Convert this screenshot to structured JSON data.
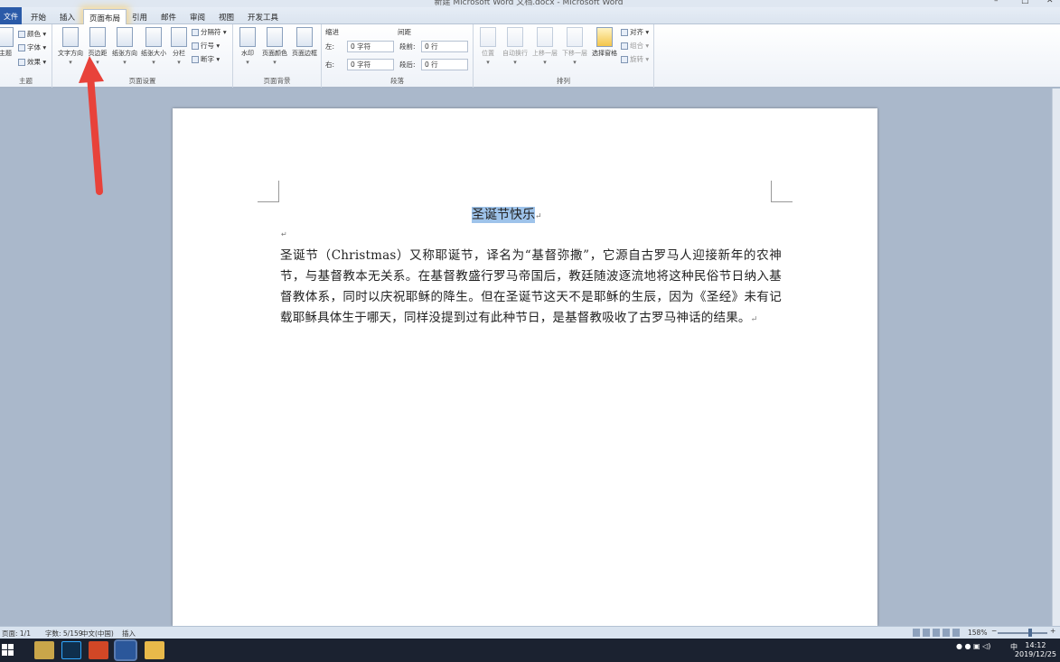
{
  "window": {
    "title": "新建 Microsoft Word 文档.docx - Microsoft Word",
    "minimize": "–",
    "maximize": "□",
    "close": "✕"
  },
  "tabs": [
    {
      "label": "文件"
    },
    {
      "label": "开始"
    },
    {
      "label": "插入"
    },
    {
      "label": "页面布局"
    },
    {
      "label": "引用"
    },
    {
      "label": "邮件"
    },
    {
      "label": "审阅"
    },
    {
      "label": "视图"
    },
    {
      "label": "开发工具"
    }
  ],
  "ribbon": {
    "theme_group": {
      "label": "主题",
      "theme_button": "主题",
      "colors": "颜色",
      "fonts": "字体",
      "effects": "效果"
    },
    "page_setup_group": {
      "label": "页面设置",
      "text_direction": "文字方向",
      "margins": "页边距",
      "orientation": "纸张方向",
      "size": "纸张大小",
      "columns": "分栏",
      "breaks": "分隔符",
      "line_numbers": "行号",
      "hyphenation": "断字"
    },
    "page_background_group": {
      "label": "页面背景",
      "watermark": "水印",
      "page_color": "页面颜色",
      "page_borders": "页面边框"
    },
    "paragraph_group": {
      "label": "段落",
      "indent_label": "缩进",
      "spacing_label": "间距",
      "left_label": "左:",
      "right_label": "右:",
      "before_label": "段前:",
      "after_label": "段后:",
      "left_value": "0 字符",
      "right_value": "0 字符",
      "before_value": "0 行",
      "after_value": "0 行"
    },
    "arrange_group": {
      "label": "排列",
      "position": "位置",
      "wrap_text": "自动换行",
      "bring_forward": "上移一层",
      "send_backward": "下移一层",
      "selection_pane": "选择窗格",
      "align": "对齐",
      "group": "组合",
      "rotate": "旋转"
    }
  },
  "document": {
    "title": "圣诞节快乐",
    "paragraph": "圣诞节（Christmas）又称耶诞节，译名为“基督弥撒”，它源自古罗马人迎接新年的农神节，与基督教本无关系。在基督教盛行罗马帝国后，教廷随波逐流地将这种民俗节日纳入基督教体系，同时以庆祝耶稣的降生。但在圣诞节这天不是耶稣的生辰，因为《圣经》未有记载耶稣具体生于哪天，同样没提到过有此种节日，是基督教吸收了古罗马神话的结果。",
    "paragraph_mark": "↵"
  },
  "status_bar": {
    "page": "页面: 1/1",
    "words": "字数: 5/159",
    "language": "中文(中国)",
    "mode": "插入",
    "zoom": "158%",
    "zoom_minus": "−",
    "zoom_plus": "+"
  },
  "taskbar": {
    "ime": "中",
    "time": "14:12",
    "date": "2019/12/25"
  },
  "colors": {
    "file_tab": "#2a5aa8",
    "selection": "#9ec3ea",
    "annotation_arrow": "#e8423a"
  }
}
